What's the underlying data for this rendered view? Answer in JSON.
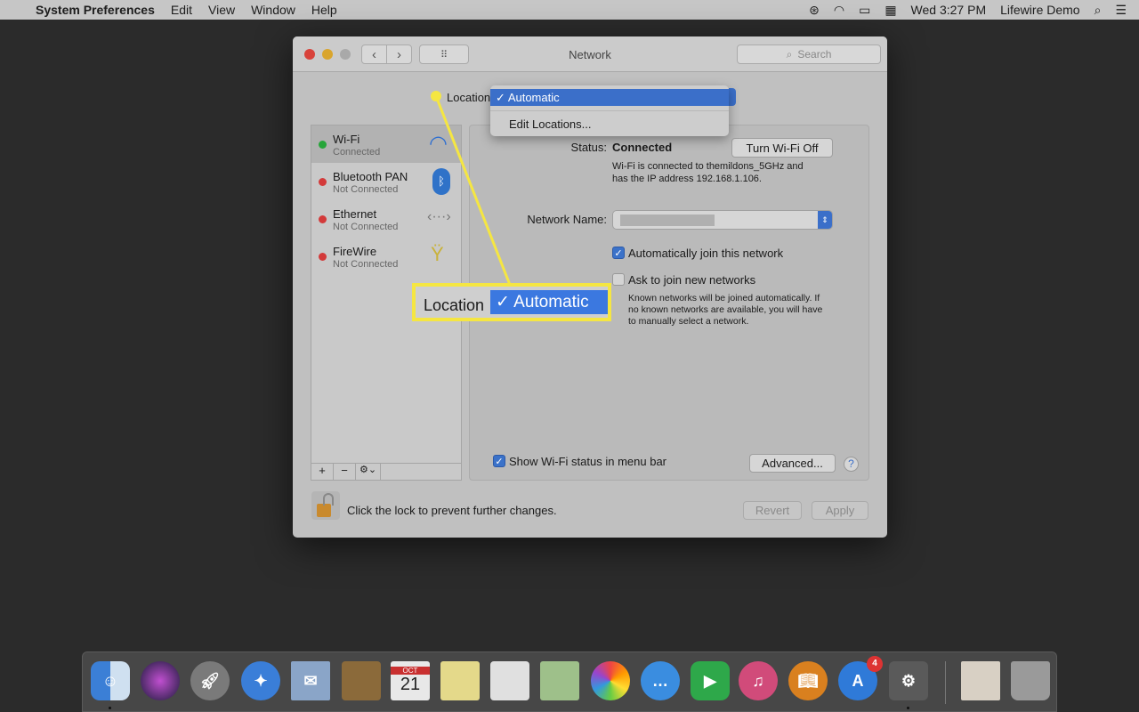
{
  "menubar": {
    "app": "System Preferences",
    "items": [
      "Edit",
      "View",
      "Window",
      "Help"
    ],
    "clock": "Wed 3:27 PM",
    "user": "Lifewire Demo",
    "icons": [
      "apple-icon",
      "creative-cloud-icon",
      "wifi-icon",
      "battery-icon",
      "keyboard-viewer-icon",
      "spotlight-icon",
      "notification-center-icon"
    ]
  },
  "window": {
    "title": "Network",
    "search_placeholder": "Search"
  },
  "location": {
    "label": "Location:",
    "menu": {
      "selected": "Automatic",
      "check": "✓",
      "edit": "Edit Locations..."
    }
  },
  "services": [
    {
      "name": "Wi-Fi",
      "status": "Connected",
      "dot": "#27a53a",
      "icon": "wifi-icon"
    },
    {
      "name": "Bluetooth PAN",
      "status": "Not Connected",
      "dot": "#d33a3a",
      "icon": "bluetooth-icon"
    },
    {
      "name": "Ethernet",
      "status": "Not Connected",
      "dot": "#d33a3a",
      "icon": "ethernet-icon"
    },
    {
      "name": "FireWire",
      "status": "Not Connected",
      "dot": "#d33a3a",
      "icon": "firewire-icon"
    }
  ],
  "list_toolbar": {
    "add": "+",
    "remove": "−",
    "gear": "⚙︎⌄"
  },
  "detail": {
    "status_label": "Status:",
    "status_value": "Connected",
    "turn_off": "Turn Wi-Fi Off",
    "status_desc_1": "Wi-Fi is connected to themildons_5GHz and",
    "status_desc_2": "has the IP address 192.168.1.106.",
    "network_name_label": "Network Name:",
    "auto_join": {
      "label": "Automatically join this network",
      "checked": true
    },
    "ask_join": {
      "label": "Ask to join new networks",
      "checked": false
    },
    "ask_help_1": "Known networks will be joined automatically. If",
    "ask_help_2": "no known networks are available, you will have",
    "ask_help_3": "to manually select a network.",
    "show_status": {
      "label": "Show Wi-Fi status in menu bar",
      "checked": true
    },
    "advanced": "Advanced...",
    "help": "?"
  },
  "footer": {
    "lock_text": "Click the lock to prevent further changes.",
    "revert": "Revert",
    "apply": "Apply"
  },
  "callout": {
    "label": "Location",
    "check": "✓",
    "value": "Automatic",
    "color": "#f5e642"
  },
  "dock": {
    "calendar_month": "OCT",
    "calendar_day": "21",
    "appstore_badge": "4",
    "apps": [
      "finder",
      "siri",
      "launchpad",
      "safari",
      "mail",
      "contacts",
      "calendar",
      "notes",
      "reminders",
      "maps",
      "photos",
      "messages",
      "facetime",
      "itunes",
      "ibooks",
      "app-store",
      "system-preferences",
      "downloads",
      "trash"
    ]
  }
}
